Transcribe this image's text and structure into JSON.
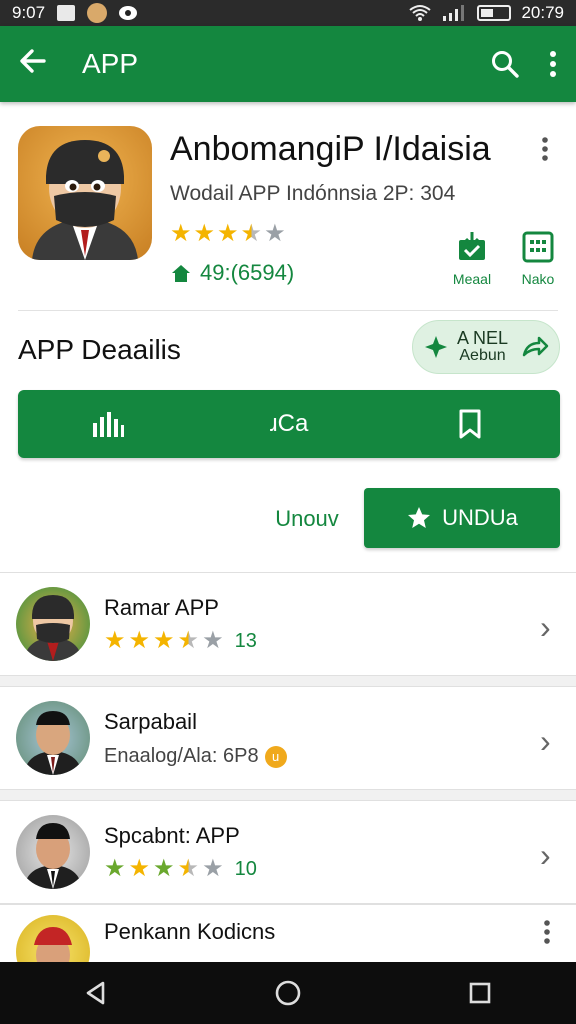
{
  "status_bar": {
    "time": "9:07",
    "clock_right": "20:79"
  },
  "toolbar": {
    "title": "APP",
    "back_icon": "arrow-left-icon",
    "search_icon": "search-icon",
    "more_icon": "more-vert-icon"
  },
  "app": {
    "name": "AnbomangiP I/Idaisia",
    "subtitle": "Wodail APP Indónnsia 2P: 304",
    "rating": 3.5,
    "downloads": "49:(6594)",
    "actions": [
      {
        "label": "Meaal",
        "icon": "download-check-icon"
      },
      {
        "label": "Nako",
        "icon": "grid-icon"
      }
    ]
  },
  "details": {
    "title": "APP Deaailis",
    "pill": {
      "top": "A NEL",
      "bottom": "Aebun"
    },
    "segments": [
      {
        "icon": "bar-chart-icon"
      },
      {
        "label": "ɹCa"
      },
      {
        "icon": "bookmark-icon"
      }
    ],
    "uninstall_label": "Unouv",
    "install_label": "UNDUa"
  },
  "list": [
    {
      "title": "Ramar APP",
      "rating": 3.5,
      "count": "13",
      "type": "rating"
    },
    {
      "title": "Sarpabail",
      "subtitle": "Enaalog/Ala: 6P8",
      "badge": "u",
      "type": "subtitle"
    },
    {
      "title": "Spcabnt: APP",
      "rating": 3.5,
      "count": "10",
      "type": "rating"
    },
    {
      "title": "Penkann Kodicns",
      "type": "more"
    }
  ],
  "colors": {
    "primary": "#14873f",
    "star": "#f4b400"
  }
}
